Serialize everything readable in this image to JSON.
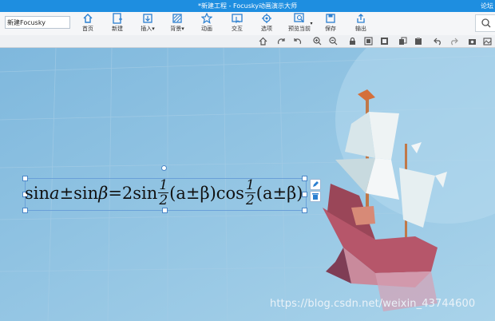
{
  "window": {
    "title": "*新建工程 - Focusky动画演示大师",
    "right_link": "论坛"
  },
  "project_name": "新建Focusky",
  "ribbon": [
    {
      "label": "首页",
      "icon": "home-icon"
    },
    {
      "label": "新建",
      "icon": "new-file-icon"
    },
    {
      "label": "插入",
      "icon": "insert-icon"
    },
    {
      "label": "背景",
      "icon": "background-icon"
    },
    {
      "label": "动画",
      "icon": "star-animation-icon"
    },
    {
      "label": "交互",
      "icon": "interaction-icon"
    },
    {
      "label": "选项",
      "icon": "options-gear-icon"
    },
    {
      "label": "预览当前",
      "icon": "preview-icon"
    },
    {
      "label": "保存",
      "icon": "save-icon"
    },
    {
      "label": "输出",
      "icon": "export-icon"
    }
  ],
  "formula": {
    "part1": "sin",
    "a1": "a",
    "pm1": "±sin",
    "b1": "β",
    "eq": "=2sin",
    "frac_num": "1",
    "frac_den": "2",
    "paren1": "(a±β)cos",
    "paren2": "(a±β)"
  },
  "watermark": "https://blog.csdn.net/weixin_43744600",
  "colors": {
    "titlebar": "#1e8ee0",
    "canvas": "#8fc4e2",
    "ribbon_icon": "#2a7fd0"
  }
}
